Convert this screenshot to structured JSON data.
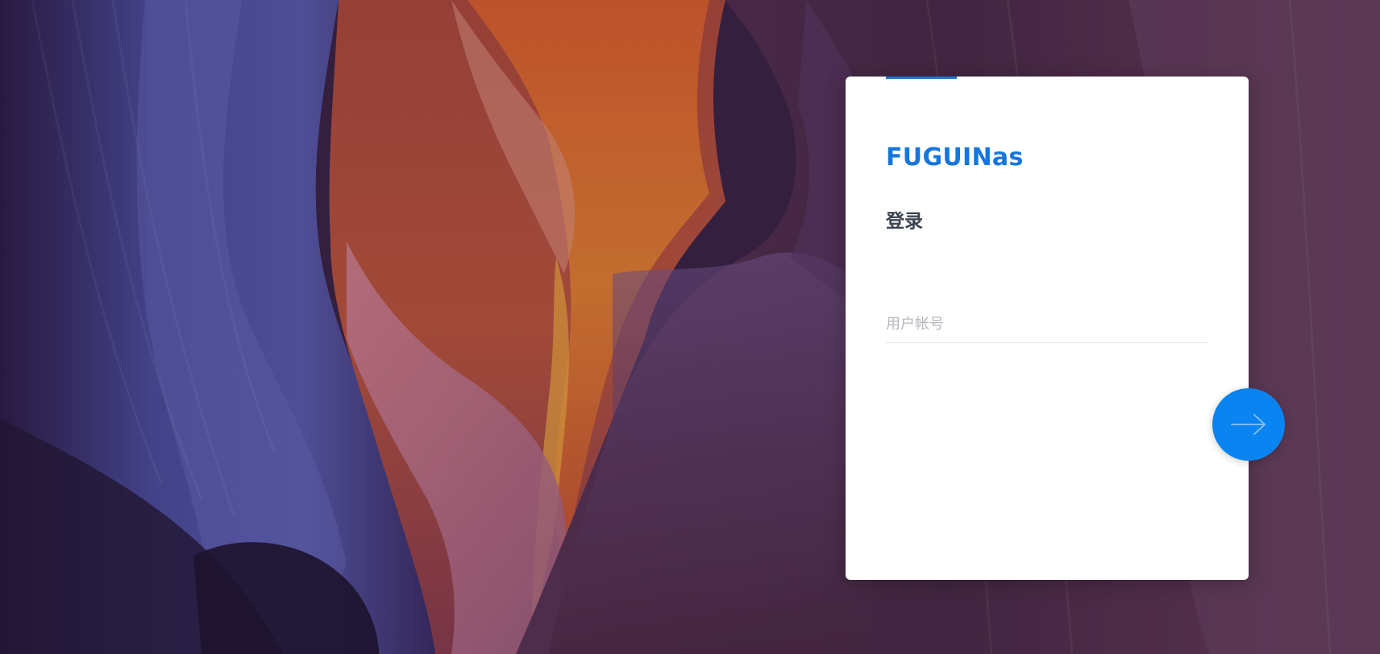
{
  "app": {
    "brand": "FUGUINas"
  },
  "login": {
    "heading": "登录",
    "username_placeholder": "用户帐号",
    "username_value": "",
    "submit_icon": "arrow-right-icon"
  },
  "colors": {
    "brand_blue": "#1577dd",
    "button_blue": "#0a84f0",
    "accent_bar": "#1c77d8",
    "heading_text": "#3a4250",
    "placeholder_text": "#b4b7bd"
  },
  "background": {
    "image": "canyon-background-image"
  }
}
